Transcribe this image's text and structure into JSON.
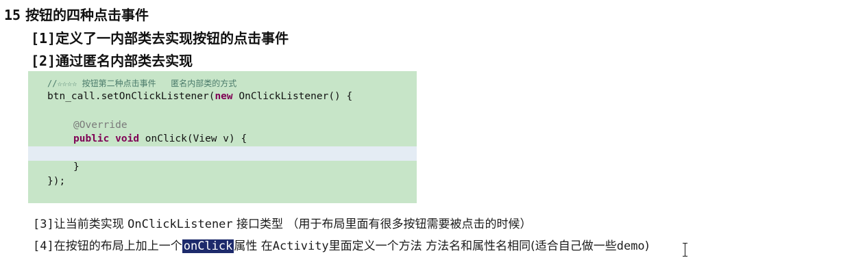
{
  "heading": {
    "number": "15",
    "text": "按钮的四种点击事件"
  },
  "items": [
    {
      "tag": "[1]",
      "text": "定义了一内部类去实现按钮的点击事件"
    },
    {
      "tag": "[2]",
      "text": "通过匿名内部类去实现"
    }
  ],
  "code": {
    "comment": "//☆☆☆☆ 按钮第二种点击事件   匿名内部类的方式",
    "line2_pre": "btn_call.setOnClickListener(",
    "kw_new": "new",
    "line2_post": " OnClickListener() {",
    "annotation": "@Override",
    "kw_public": "public",
    "kw_void": "void",
    "line5_post": " onClick(View v) {",
    "close1": "}",
    "close2": "});"
  },
  "notes": {
    "item3_tag": "[3]",
    "item3_text_a": "让当前类实现 ",
    "item3_code": "OnClickListener",
    "item3_text_b": " 接口类型 （用于布局里面有很多按钮需要被点击的时候）",
    "item4_tag": "[4]",
    "item4_text_a": "在按钮的布局上加上一个",
    "item4_selected": "onClick",
    "item4_text_b": "属性   在",
    "item4_code": "Activity",
    "item4_text_c": "里面定义一个方法 方法名和属性名相同(适合自己做一些",
    "item4_code2": "demo",
    "item4_text_d": ")"
  }
}
